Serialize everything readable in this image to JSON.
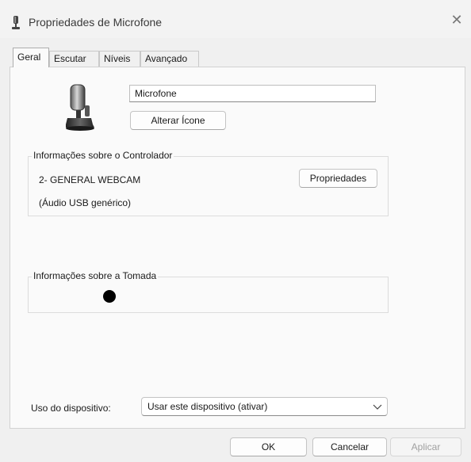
{
  "window": {
    "title": "Propriedades de Microfone",
    "close_icon": "close-icon",
    "title_icon": "microphone-icon"
  },
  "tabs": [
    {
      "label": "Geral",
      "active": true
    },
    {
      "label": "Escutar",
      "active": false
    },
    {
      "label": "Níveis",
      "active": false
    },
    {
      "label": "Avançado",
      "active": false
    }
  ],
  "general": {
    "device_icon": "microphone-icon",
    "device_name": "Microfone",
    "change_icon_label": "Alterar Ícone",
    "controller_group": {
      "legend": "Informações sobre o Controlador",
      "controller_name": "2- GENERAL WEBCAM",
      "driver_desc": "(Áudio USB genérico)",
      "properties_label": "Propriedades"
    },
    "jack_group": {
      "legend": "Informações sobre a Tomada",
      "jack_color": "#000000"
    },
    "device_usage": {
      "label": "Uso do dispositivo:",
      "selected": "Usar este dispositivo (ativar)"
    }
  },
  "footer": {
    "ok_label": "OK",
    "cancel_label": "Cancelar",
    "apply_label": "Aplicar",
    "apply_enabled": false
  }
}
